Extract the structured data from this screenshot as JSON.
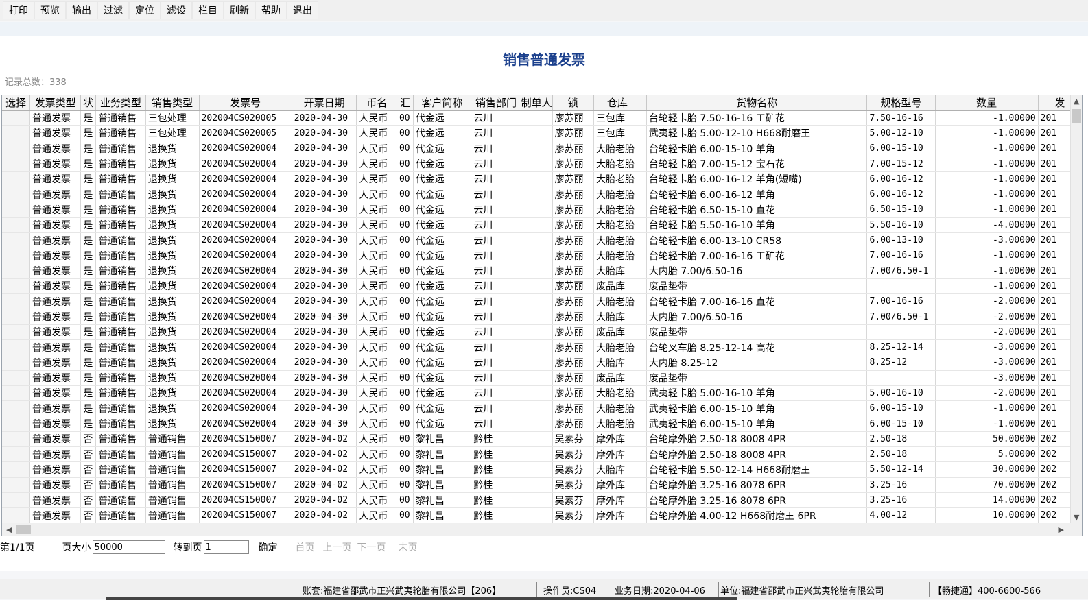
{
  "toolbar": {
    "buttons": [
      "打印",
      "预览",
      "输出",
      "过滤",
      "定位",
      "滤设",
      "栏目",
      "刷新",
      "帮助",
      "退出"
    ]
  },
  "page": {
    "title": "销售普通发票",
    "record_count": "记录总数：338"
  },
  "table": {
    "columns": [
      "选择",
      "发票类型",
      "状",
      "业务类型",
      "销售类型",
      "发票号",
      "开票日期",
      "币名",
      "汇",
      "客户简称",
      "销售部门",
      "制单人",
      "锁",
      "仓库",
      "",
      "货物名称",
      "规格型号",
      "数量",
      "发"
    ],
    "rows": [
      [
        "",
        "普通发票",
        "是",
        "普通销售",
        "三包处理",
        "202004CS020005",
        "2020-04-30",
        "人民币",
        "00",
        "代金远",
        "云川",
        "",
        "廖苏丽",
        "三包库",
        "",
        "台轮轻卡胎  7.50-16-16  工矿花",
        "7.50-16-16",
        "-1.00000",
        "201"
      ],
      [
        "",
        "普通发票",
        "是",
        "普通销售",
        "三包处理",
        "202004CS020005",
        "2020-04-30",
        "人民币",
        "00",
        "代金远",
        "云川",
        "",
        "廖苏丽",
        "三包库",
        "",
        "武夷轻卡胎 5.00-12-10  H668耐磨王",
        "5.00-12-10",
        "-1.00000",
        "201"
      ],
      [
        "",
        "普通发票",
        "是",
        "普通销售",
        "退换货",
        "202004CS020004",
        "2020-04-30",
        "人民币",
        "00",
        "代金远",
        "云川",
        "",
        "廖苏丽",
        "大胎老胎",
        "",
        "台轮轻卡胎  6.00-15-10  羊角",
        "6.00-15-10",
        "-1.00000",
        "201"
      ],
      [
        "",
        "普通发票",
        "是",
        "普通销售",
        "退换货",
        "202004CS020004",
        "2020-04-30",
        "人民币",
        "00",
        "代金远",
        "云川",
        "",
        "廖苏丽",
        "大胎老胎",
        "",
        "台轮轻卡胎  7.00-15-12  宝石花",
        "7.00-15-12",
        "-1.00000",
        "201"
      ],
      [
        "",
        "普通发票",
        "是",
        "普通销售",
        "退换货",
        "202004CS020004",
        "2020-04-30",
        "人民币",
        "00",
        "代金远",
        "云川",
        "",
        "廖苏丽",
        "大胎老胎",
        "",
        "台轮轻卡胎  6.00-16-12  羊角(短嘴)",
        "6.00-16-12",
        "-1.00000",
        "201"
      ],
      [
        "",
        "普通发票",
        "是",
        "普通销售",
        "退换货",
        "202004CS020004",
        "2020-04-30",
        "人民币",
        "00",
        "代金远",
        "云川",
        "",
        "廖苏丽",
        "大胎老胎",
        "",
        "台轮轻卡胎  6.00-16-12  羊角",
        "6.00-16-12",
        "-1.00000",
        "201"
      ],
      [
        "",
        "普通发票",
        "是",
        "普通销售",
        "退换货",
        "202004CS020004",
        "2020-04-30",
        "人民币",
        "00",
        "代金远",
        "云川",
        "",
        "廖苏丽",
        "大胎老胎",
        "",
        "台轮轻卡胎  6.50-15-10  直花",
        "6.50-15-10",
        "-1.00000",
        "201"
      ],
      [
        "",
        "普通发票",
        "是",
        "普通销售",
        "退换货",
        "202004CS020004",
        "2020-04-30",
        "人民币",
        "00",
        "代金远",
        "云川",
        "",
        "廖苏丽",
        "大胎老胎",
        "",
        "台轮轻卡胎  5.50-16-10  羊角",
        "5.50-16-10",
        "-4.00000",
        "201"
      ],
      [
        "",
        "普通发票",
        "是",
        "普通销售",
        "退换货",
        "202004CS020004",
        "2020-04-30",
        "人民币",
        "00",
        "代金远",
        "云川",
        "",
        "廖苏丽",
        "大胎老胎",
        "",
        "台轮轻卡胎  6.00-13-10  CR58",
        "6.00-13-10",
        "-3.00000",
        "201"
      ],
      [
        "",
        "普通发票",
        "是",
        "普通销售",
        "退换货",
        "202004CS020004",
        "2020-04-30",
        "人民币",
        "00",
        "代金远",
        "云川",
        "",
        "廖苏丽",
        "大胎老胎",
        "",
        "台轮轻卡胎  7.00-16-16  工矿花",
        "7.00-16-16",
        "-1.00000",
        "201"
      ],
      [
        "",
        "普通发票",
        "是",
        "普通销售",
        "退换货",
        "202004CS020004",
        "2020-04-30",
        "人民币",
        "00",
        "代金远",
        "云川",
        "",
        "廖苏丽",
        "大胎库",
        "",
        "大内胎  7.00/6.50-16",
        "7.00/6.50-1",
        "-1.00000",
        "201"
      ],
      [
        "",
        "普通发票",
        "是",
        "普通销售",
        "退换货",
        "202004CS020004",
        "2020-04-30",
        "人民币",
        "00",
        "代金远",
        "云川",
        "",
        "廖苏丽",
        "废品库",
        "",
        "废品垫带",
        "",
        "-1.00000",
        "201"
      ],
      [
        "",
        "普通发票",
        "是",
        "普通销售",
        "退换货",
        "202004CS020004",
        "2020-04-30",
        "人民币",
        "00",
        "代金远",
        "云川",
        "",
        "廖苏丽",
        "大胎老胎",
        "",
        "台轮轻卡胎  7.00-16-16  直花",
        "7.00-16-16",
        "-2.00000",
        "201"
      ],
      [
        "",
        "普通发票",
        "是",
        "普通销售",
        "退换货",
        "202004CS020004",
        "2020-04-30",
        "人民币",
        "00",
        "代金远",
        "云川",
        "",
        "廖苏丽",
        "大胎库",
        "",
        "大内胎  7.00/6.50-16",
        "7.00/6.50-1",
        "-2.00000",
        "201"
      ],
      [
        "",
        "普通发票",
        "是",
        "普通销售",
        "退换货",
        "202004CS020004",
        "2020-04-30",
        "人民币",
        "00",
        "代金远",
        "云川",
        "",
        "廖苏丽",
        "废品库",
        "",
        "废品垫带",
        "",
        "-2.00000",
        "201"
      ],
      [
        "",
        "普通发票",
        "是",
        "普通销售",
        "退换货",
        "202004CS020004",
        "2020-04-30",
        "人民币",
        "00",
        "代金远",
        "云川",
        "",
        "廖苏丽",
        "大胎老胎",
        "",
        "台轮叉车胎  8.25-12-14  高花",
        "8.25-12-14",
        "-3.00000",
        "201"
      ],
      [
        "",
        "普通发票",
        "是",
        "普通销售",
        "退换货",
        "202004CS020004",
        "2020-04-30",
        "人民币",
        "00",
        "代金远",
        "云川",
        "",
        "廖苏丽",
        "大胎库",
        "",
        "大内胎  8.25-12",
        "8.25-12",
        "-3.00000",
        "201"
      ],
      [
        "",
        "普通发票",
        "是",
        "普通销售",
        "退换货",
        "202004CS020004",
        "2020-04-30",
        "人民币",
        "00",
        "代金远",
        "云川",
        "",
        "廖苏丽",
        "废品库",
        "",
        "废品垫带",
        "",
        "-3.00000",
        "201"
      ],
      [
        "",
        "普通发票",
        "是",
        "普通销售",
        "退换货",
        "202004CS020004",
        "2020-04-30",
        "人民币",
        "00",
        "代金远",
        "云川",
        "",
        "廖苏丽",
        "大胎老胎",
        "",
        "武夷轻卡胎  5.00-16-10  羊角",
        "5.00-16-10",
        "-2.00000",
        "201"
      ],
      [
        "",
        "普通发票",
        "是",
        "普通销售",
        "退换货",
        "202004CS020004",
        "2020-04-30",
        "人民币",
        "00",
        "代金远",
        "云川",
        "",
        "廖苏丽",
        "大胎老胎",
        "",
        "武夷轻卡胎  6.00-15-10  羊角",
        "6.00-15-10",
        "-1.00000",
        "201"
      ],
      [
        "",
        "普通发票",
        "是",
        "普通销售",
        "退换货",
        "202004CS020004",
        "2020-04-30",
        "人民币",
        "00",
        "代金远",
        "云川",
        "",
        "廖苏丽",
        "大胎老胎",
        "",
        "武夷轻卡胎  6.00-15-10  羊角",
        "6.00-15-10",
        "-1.00000",
        "201"
      ],
      [
        "",
        "普通发票",
        "否",
        "普通销售",
        "普通销售",
        "202004CS150007",
        "2020-04-02",
        "人民币",
        "00",
        "黎礼昌",
        "黔桂",
        "",
        "吴素芬",
        "摩外库",
        "",
        "台轮摩外胎  2.50-18  8008  4PR",
        "2.50-18",
        "50.00000",
        "202"
      ],
      [
        "",
        "普通发票",
        "否",
        "普通销售",
        "普通销售",
        "202004CS150007",
        "2020-04-02",
        "人民币",
        "00",
        "黎礼昌",
        "黔桂",
        "",
        "吴素芬",
        "摩外库",
        "",
        "台轮摩外胎  2.50-18  8008  4PR",
        "2.50-18",
        "5.00000",
        "202"
      ],
      [
        "",
        "普通发票",
        "否",
        "普通销售",
        "普通销售",
        "202004CS150007",
        "2020-04-02",
        "人民币",
        "00",
        "黎礼昌",
        "黔桂",
        "",
        "吴素芬",
        "大胎库",
        "",
        "台轮轻卡胎  5.50-12-14 H668耐磨王",
        "5.50-12-14",
        "30.00000",
        "202"
      ],
      [
        "",
        "普通发票",
        "否",
        "普通销售",
        "普通销售",
        "202004CS150007",
        "2020-04-02",
        "人民币",
        "00",
        "黎礼昌",
        "黔桂",
        "",
        "吴素芬",
        "摩外库",
        "",
        "台轮摩外胎  3.25-16  8078  6PR",
        "3.25-16",
        "70.00000",
        "202"
      ],
      [
        "",
        "普通发票",
        "否",
        "普通销售",
        "普通销售",
        "202004CS150007",
        "2020-04-02",
        "人民币",
        "00",
        "黎礼昌",
        "黔桂",
        "",
        "吴素芬",
        "摩外库",
        "",
        "台轮摩外胎  3.25-16  8078  6PR",
        "3.25-16",
        "14.00000",
        "202"
      ],
      [
        "",
        "普通发票",
        "否",
        "普通销售",
        "普通销售",
        "202004CS150007",
        "2020-04-02",
        "人民币",
        "00",
        "黎礼昌",
        "黔桂",
        "",
        "吴素芬",
        "摩外库",
        "",
        "台轮摩外胎  4.00-12  H668耐磨王  6PR",
        "4.00-12",
        "10.00000",
        "202"
      ]
    ]
  },
  "pager": {
    "page_info": "第1/1页",
    "page_size_label": "页大小",
    "page_size_value": "50000",
    "goto_label": "转到页",
    "goto_value": "1",
    "confirm": "确定",
    "first": "首页",
    "prev": "上一页",
    "next": "下一页",
    "last": "末页"
  },
  "status": {
    "account": "账套:福建省邵武市正兴武夷轮胎有限公司【206】",
    "operator": "操作员:CS04",
    "business_date": "业务日期:2020-04-06",
    "unit": "单位:福建省邵武市正兴武夷轮胎有限公司",
    "support": "【畅捷通】400-6600-566"
  },
  "colors": {
    "title": "#1a3f8c",
    "header_bg": "#f4f4f4",
    "link_disabled": "#aaaaaa"
  }
}
